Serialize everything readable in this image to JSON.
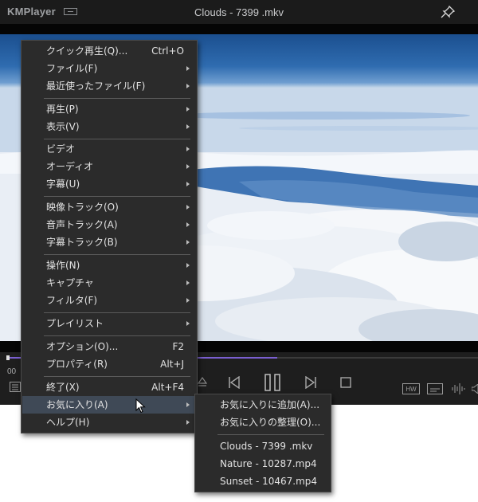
{
  "window": {
    "app_name": "KMPlayer",
    "title": "Clouds - 7399 .mkv"
  },
  "controls": {
    "time": "00",
    "playback_progress": 0.0,
    "subtitle_indicator": "HW"
  },
  "main_menu": {
    "items": [
      {
        "label": "クイック再生(Q)...",
        "shortcut": "Ctrl+O",
        "submenu": false
      },
      {
        "label": "ファイル(F)",
        "shortcut": "",
        "submenu": true
      },
      {
        "label": "最近使ったファイル(F)",
        "shortcut": "",
        "submenu": true
      },
      {
        "label": "再生(P)",
        "shortcut": "",
        "submenu": true
      },
      {
        "label": "表示(V)",
        "shortcut": "",
        "submenu": true
      },
      {
        "label": "ビデオ",
        "shortcut": "",
        "submenu": true
      },
      {
        "label": "オーディオ",
        "shortcut": "",
        "submenu": true
      },
      {
        "label": "字幕(U)",
        "shortcut": "",
        "submenu": true
      },
      {
        "label": "映像トラック(O)",
        "shortcut": "",
        "submenu": true
      },
      {
        "label": "音声トラック(A)",
        "shortcut": "",
        "submenu": true
      },
      {
        "label": "字幕トラック(B)",
        "shortcut": "",
        "submenu": true
      },
      {
        "label": "操作(N)",
        "shortcut": "",
        "submenu": true
      },
      {
        "label": "キャプチャ",
        "shortcut": "",
        "submenu": true
      },
      {
        "label": "フィルタ(F)",
        "shortcut": "",
        "submenu": true
      },
      {
        "label": "プレイリスト",
        "shortcut": "",
        "submenu": true
      },
      {
        "label": "オプション(O)...",
        "shortcut": "F2",
        "submenu": false
      },
      {
        "label": "プロパティ(R)",
        "shortcut": "Alt+J",
        "submenu": false
      },
      {
        "label": "終了(X)",
        "shortcut": "Alt+F4",
        "submenu": false
      },
      {
        "label": "お気に入り(A)",
        "shortcut": "",
        "submenu": true,
        "highlighted": true
      },
      {
        "label": "ヘルプ(H)",
        "shortcut": "",
        "submenu": true
      }
    ]
  },
  "favorites_menu": {
    "items": [
      {
        "label": "お気に入りに追加(A)..."
      },
      {
        "label": "お気に入りの整理(O)..."
      },
      {
        "label": "Clouds - 7399 .mkv"
      },
      {
        "label": "Nature - 10287.mp4"
      },
      {
        "label": "Sunset - 10467.mp4"
      }
    ]
  },
  "colors": {
    "menu_bg": "#2b2b2b",
    "menu_highlight": "#3f4956",
    "seek_fill": "#7a5fd0"
  }
}
